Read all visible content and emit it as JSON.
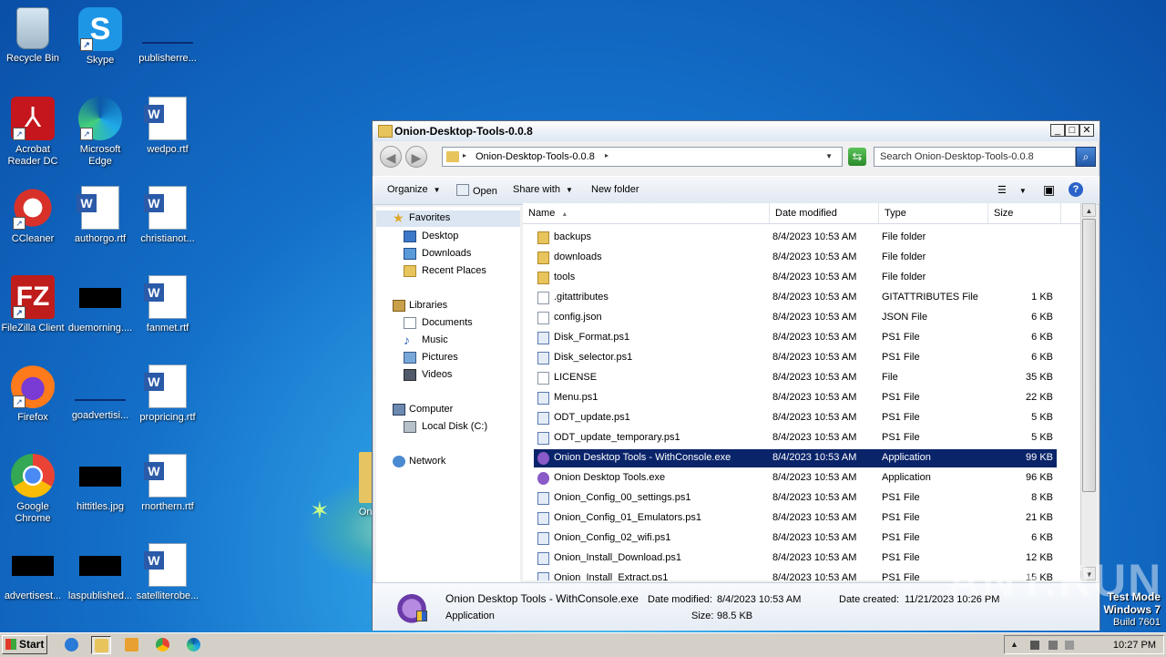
{
  "desktop": {
    "icons": [
      {
        "label": "Recycle Bin"
      },
      {
        "label": "Skype"
      },
      {
        "label": "publisherre..."
      },
      {
        "label": "Acrobat Reader DC"
      },
      {
        "label": "Microsoft Edge"
      },
      {
        "label": "wedpo.rtf"
      },
      {
        "label": "CCleaner"
      },
      {
        "label": "authorgo.rtf"
      },
      {
        "label": "christianot..."
      },
      {
        "label": "FileZilla Client"
      },
      {
        "label": "duemorning...."
      },
      {
        "label": "fanmet.rtf"
      },
      {
        "label": "Firefox"
      },
      {
        "label": "goadvertisi..."
      },
      {
        "label": "propricing.rtf"
      },
      {
        "label": "Google Chrome"
      },
      {
        "label": "hittitles.jpg"
      },
      {
        "label": "rnorthern.rtf"
      },
      {
        "label": "advertisest..."
      },
      {
        "label": "laspublished..."
      },
      {
        "label": "satelliterobe..."
      },
      {
        "label": "Onion-..."
      }
    ],
    "skype_glyph": "S",
    "acrobat_glyph": "⅄",
    "filezilla_glyph": "FZ",
    "shortcut_glyph": "↗"
  },
  "window": {
    "title": "Onion-Desktop-Tools-0.0.8",
    "controls": {
      "minimize": "_",
      "maximize": "□",
      "close": "✕"
    },
    "nav": {
      "back": "◀",
      "forward": "▶"
    },
    "address": {
      "path": "Onion-Desktop-Tools-0.0.8",
      "arrow": "▸",
      "dropdown": "▼"
    },
    "refresh_glyph": "⇆",
    "search": {
      "placeholder": "Search Onion-Desktop-Tools-0.0.8",
      "glyph": "⌕"
    },
    "toolbar": {
      "organize": "Organize",
      "open": "Open",
      "share_with": "Share with",
      "new_folder": "New folder",
      "dd": "▼",
      "views_glyph": "☰",
      "preview_glyph": "▣",
      "help_glyph": "?"
    },
    "navpane": {
      "favorites": "Favorites",
      "desktop": "Desktop",
      "downloads": "Downloads",
      "recent": "Recent Places",
      "libraries": "Libraries",
      "documents": "Documents",
      "music": "Music",
      "pictures": "Pictures",
      "videos": "Videos",
      "computer": "Computer",
      "local_disk": "Local Disk (C:)",
      "network": "Network",
      "star_glyph": "★",
      "music_glyph": "♪"
    },
    "columns": {
      "name": "Name",
      "sort": "▲",
      "date": "Date modified",
      "type": "Type",
      "size": "Size"
    },
    "files": [
      {
        "name": "backups",
        "date": "8/4/2023 10:53 AM",
        "type": "File folder",
        "size": "",
        "icon": "folder"
      },
      {
        "name": "downloads",
        "date": "8/4/2023 10:53 AM",
        "type": "File folder",
        "size": "",
        "icon": "folder"
      },
      {
        "name": "tools",
        "date": "8/4/2023 10:53 AM",
        "type": "File folder",
        "size": "",
        "icon": "folder"
      },
      {
        "name": ".gitattributes",
        "date": "8/4/2023 10:53 AM",
        "type": "GITATTRIBUTES File",
        "size": "1 KB",
        "icon": "file"
      },
      {
        "name": "config.json",
        "date": "8/4/2023 10:53 AM",
        "type": "JSON File",
        "size": "6 KB",
        "icon": "file"
      },
      {
        "name": "Disk_Format.ps1",
        "date": "8/4/2023 10:53 AM",
        "type": "PS1 File",
        "size": "6 KB",
        "icon": "ps1"
      },
      {
        "name": "Disk_selector.ps1",
        "date": "8/4/2023 10:53 AM",
        "type": "PS1 File",
        "size": "6 KB",
        "icon": "ps1"
      },
      {
        "name": "LICENSE",
        "date": "8/4/2023 10:53 AM",
        "type": "File",
        "size": "35 KB",
        "icon": "file"
      },
      {
        "name": "Menu.ps1",
        "date": "8/4/2023 10:53 AM",
        "type": "PS1 File",
        "size": "22 KB",
        "icon": "ps1"
      },
      {
        "name": "ODT_update.ps1",
        "date": "8/4/2023 10:53 AM",
        "type": "PS1 File",
        "size": "5 KB",
        "icon": "ps1"
      },
      {
        "name": "ODT_update_temporary.ps1",
        "date": "8/4/2023 10:53 AM",
        "type": "PS1 File",
        "size": "5 KB",
        "icon": "ps1"
      },
      {
        "name": "Onion Desktop Tools - WithConsole.exe",
        "date": "8/4/2023 10:53 AM",
        "type": "Application",
        "size": "99 KB",
        "icon": "app",
        "selected": true
      },
      {
        "name": "Onion Desktop Tools.exe",
        "date": "8/4/2023 10:53 AM",
        "type": "Application",
        "size": "96 KB",
        "icon": "app"
      },
      {
        "name": "Onion_Config_00_settings.ps1",
        "date": "8/4/2023 10:53 AM",
        "type": "PS1 File",
        "size": "8 KB",
        "icon": "ps1"
      },
      {
        "name": "Onion_Config_01_Emulators.ps1",
        "date": "8/4/2023 10:53 AM",
        "type": "PS1 File",
        "size": "21 KB",
        "icon": "ps1"
      },
      {
        "name": "Onion_Config_02_wifi.ps1",
        "date": "8/4/2023 10:53 AM",
        "type": "PS1 File",
        "size": "6 KB",
        "icon": "ps1"
      },
      {
        "name": "Onion_Install_Download.ps1",
        "date": "8/4/2023 10:53 AM",
        "type": "PS1 File",
        "size": "12 KB",
        "icon": "ps1"
      },
      {
        "name": "Onion_Install_Extract.ps1",
        "date": "8/4/2023 10:53 AM",
        "type": "PS1 File",
        "size": "15 KB",
        "icon": "ps1"
      }
    ],
    "scroll": {
      "up": "▲",
      "down": "▼"
    },
    "details": {
      "name": "Onion Desktop Tools - WithConsole.exe",
      "type": "Application",
      "modified_label": "Date modified:",
      "modified_value": "8/4/2023 10:53 AM",
      "created_label": "Date created:",
      "created_value": "11/21/2023 10:26 PM",
      "size_label": "Size:",
      "size_value": "98.5 KB"
    }
  },
  "watermark": "ANY.RUN",
  "testmode": {
    "line1": "Test Mode",
    "line2": "Windows 7",
    "line3": "Build 7601"
  },
  "taskbar": {
    "start": "Start",
    "tray_expand": "▲",
    "clock": "10:27 PM"
  }
}
